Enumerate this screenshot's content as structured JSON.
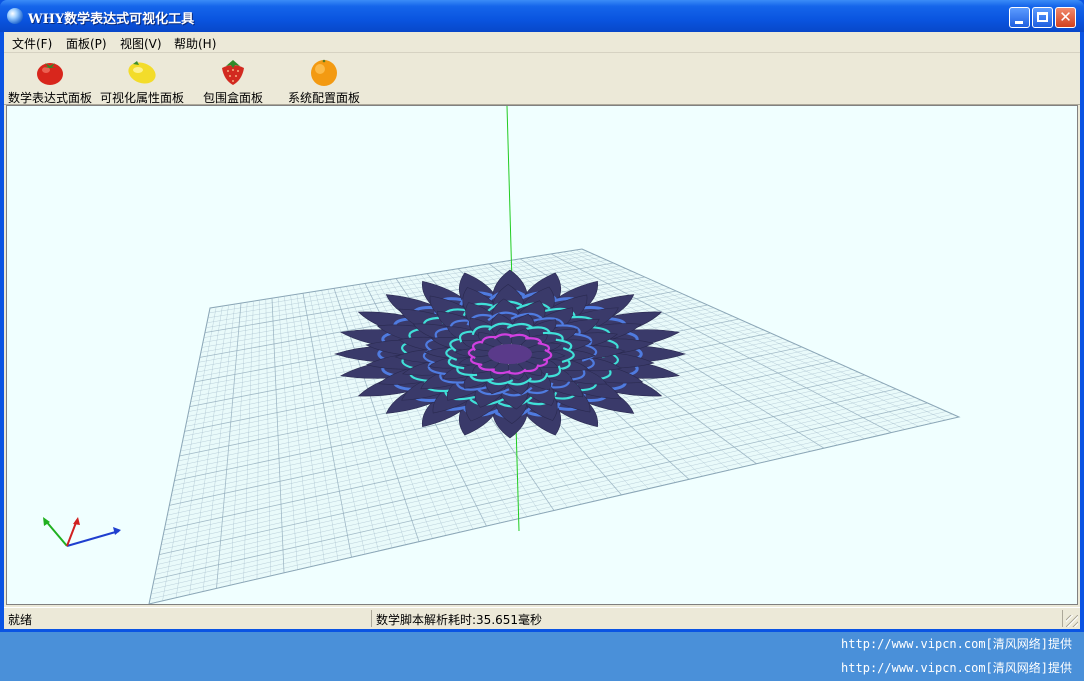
{
  "window": {
    "title": "WHY数学表达式可视化工具",
    "close_glyph": "✕"
  },
  "menu": [
    "文件(F)",
    "面板(P)",
    "视图(V)",
    "帮助(H)"
  ],
  "toolbar": [
    {
      "label": "数学表达式面板",
      "icon": "tomato-icon"
    },
    {
      "label": "可视化属性面板",
      "icon": "lemon-icon"
    },
    {
      "label": "包围盒面板",
      "icon": "strawberry-icon"
    },
    {
      "label": "系统配置面板",
      "icon": "orange-icon"
    }
  ],
  "status": {
    "ready": "就绪",
    "parse_time": "数学脚本解析耗时:35.651毫秒"
  },
  "watermarks": [
    "http://www.vipcn.com[清风网络]提供",
    "http://www.vipcn.com[清风网络]提供"
  ],
  "colors": {
    "viewport_bg": "#f0ffff",
    "grid_line": "#9fb8c8",
    "axis_green": "#22cc22",
    "petal_dark": "#3a3a6a",
    "petal_blue": "#4f7be0",
    "petal_cyan": "#40e0d8",
    "petal_magenta": "#d040e0"
  }
}
